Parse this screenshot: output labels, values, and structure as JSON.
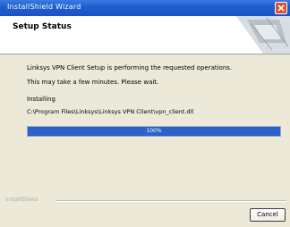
{
  "window": {
    "title": "InstallShield Wizard",
    "close_icon": "close-icon"
  },
  "header": {
    "title": "Setup Status",
    "graphic_icon": "wizard-graphic-icon"
  },
  "status": {
    "message": "Linksys VPN Client Setup is performing the requested operations.",
    "wait_message": "This may take a few minutes. Please wait.",
    "action_label": "Installing",
    "file_path": "C:\\Program Files\\Linksys\\Linksys VPN Client\\vpn_client.dll"
  },
  "progress": {
    "label": "100%",
    "fraction": 1.0,
    "color": "#2b63c8"
  },
  "footer": {
    "brand": "InstallShield",
    "cancel_label": "Cancel"
  },
  "colors": {
    "titlebar": "#1f5ecf",
    "close_button": "#d9502f",
    "dialog_background": "#ece9d8"
  }
}
